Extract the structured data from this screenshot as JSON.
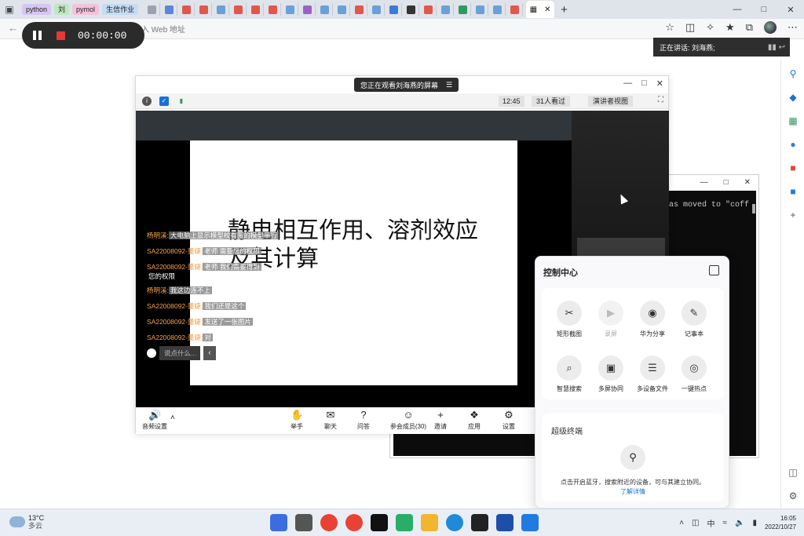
{
  "browser": {
    "bookmarks": [
      {
        "label": "python",
        "color": "#d6c7f2"
      },
      {
        "label": "刘",
        "color": "#bfe8c2"
      },
      {
        "label": "pymol",
        "color": "#f4c2dc"
      },
      {
        "label": "生信作业",
        "color": "#c4dcf5"
      }
    ],
    "tab_icon_colors": [
      "#9aa3ad",
      "#5b87d6",
      "#e2574c",
      "#e2574c",
      "#6aa0d8",
      "#e2574c",
      "#e2574c",
      "#e2574c",
      "#6aa0d8",
      "#9a62c8",
      "#6aa0d8",
      "#6aa0d8",
      "#e2574c",
      "#6aa0d8",
      "#3b7bd6",
      "#333333",
      "#e2574c",
      "#6aa0d8",
      "#2e9a5b",
      "#6aa0d8",
      "#6aa0d8",
      "#e2574c"
    ],
    "address_placeholder": "或输入 Web 地址",
    "new_tab_symbol": "+"
  },
  "recorder": {
    "time": "00:00:00"
  },
  "speaking": {
    "label": "正在讲话: 刘海燕;"
  },
  "meeting": {
    "viewing_banner": "您正在观看刘海燕的屏幕",
    "time": "12:45",
    "viewers": "31人看过",
    "view_mode": "演讲者视图",
    "slide_title": "静电相互作用、溶剂效应及其计算",
    "chat": [
      {
        "name": "杨明溪:",
        "text": "大电脑上显示模型校有图的模型平行"
      },
      {
        "name": "SA22008092-董婕:",
        "text": "老师 需要您的权限"
      },
      {
        "name": "SA22008092-董婕:",
        "text": "老师 我们需要得到",
        "text2": "您的权限"
      },
      {
        "name": "杨明溪:",
        "text": "我这边连不上"
      },
      {
        "name": "SA22008092-董婕:",
        "text": "我们还是这个"
      },
      {
        "name": "SA22008092-董婕:",
        "text": "发送了一张图片"
      },
      {
        "name": "SA22008092-董婕:",
        "text": "对"
      }
    ],
    "chat_placeholder": "说点什么...",
    "toolbar": {
      "audio": "音频设置",
      "items": [
        {
          "label": "举手",
          "icon": "hand-icon"
        },
        {
          "label": "聊天",
          "icon": "chat-icon"
        },
        {
          "label": "问答",
          "icon": "question-icon"
        },
        {
          "label": "参会成员(30)",
          "icon": "members-icon"
        },
        {
          "label": "邀请",
          "icon": "invite-icon"
        },
        {
          "label": "应用",
          "icon": "apps-icon"
        },
        {
          "label": "设置",
          "icon": "settings-icon"
        }
      ]
    }
  },
  "terminal": {
    "text": "as moved to \"coff"
  },
  "control_center": {
    "title": "控制中心",
    "items": [
      {
        "label": "矩形截图",
        "icon": "screenshot-icon",
        "enabled": true
      },
      {
        "label": "录屏",
        "icon": "record-icon",
        "enabled": false
      },
      {
        "label": "华为分享",
        "icon": "share-icon",
        "enabled": true
      },
      {
        "label": "记事本",
        "icon": "notepad-icon",
        "enabled": true
      },
      {
        "label": "智慧搜索",
        "icon": "search-icon",
        "enabled": true
      },
      {
        "label": "多屏协同",
        "icon": "multiscreen-icon",
        "enabled": true
      },
      {
        "label": "多设备文件",
        "icon": "files-icon",
        "enabled": true
      },
      {
        "label": "一键热点",
        "icon": "hotspot-icon",
        "enabled": true
      }
    ],
    "super_terminal": "超级终端",
    "hint": "点击开启蓝牙，搜索附近的设备，可与其建立协同。",
    "learn_more": "了解详情"
  },
  "taskbar": {
    "temperature": "13°C",
    "weather": "多云",
    "ime": "中",
    "time": "16:05",
    "date": "2022/10/27",
    "app_colors": [
      "#3a6ee0",
      "#555555",
      "#e94235",
      "#e94235",
      "#111111",
      "#2aae67",
      "#f2b530",
      "#1f8ad8",
      "#222222",
      "#1e4fa8",
      "#1f7be0"
    ]
  }
}
